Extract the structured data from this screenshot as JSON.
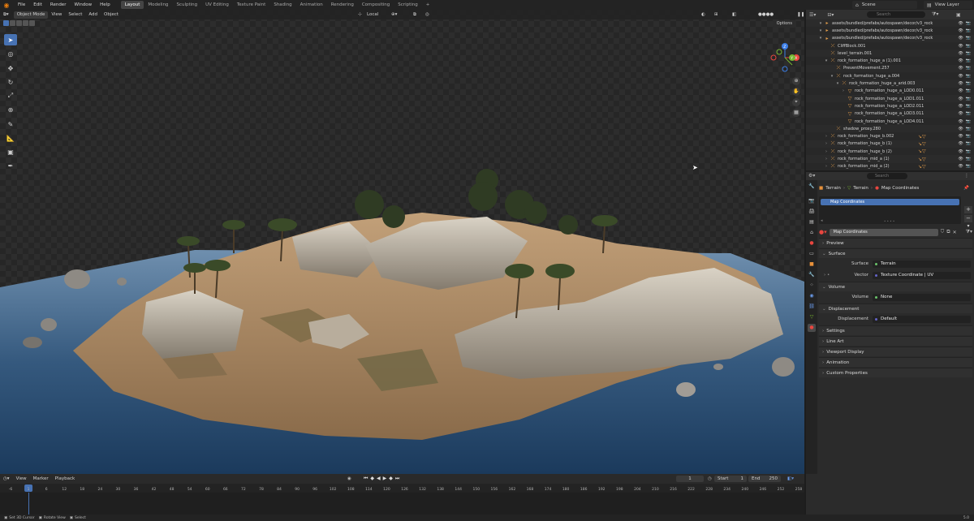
{
  "topbar": {
    "menus": [
      "File",
      "Edit",
      "Render",
      "Window",
      "Help"
    ],
    "workspaces": [
      "Layout",
      "Modeling",
      "Sculpting",
      "UV Editing",
      "Texture Paint",
      "Shading",
      "Animation",
      "Rendering",
      "Compositing",
      "Scripting"
    ],
    "active_workspace": "Layout",
    "add_tab": "+",
    "scene": "Scene",
    "view_layer": "View Layer"
  },
  "viewport": {
    "mode": "Object Mode",
    "menus": [
      "View",
      "Select",
      "Add",
      "Object"
    ],
    "transform_orientation": "Local",
    "options": "Options",
    "gizmo": {
      "x": "X",
      "y": "Y",
      "z": "Z"
    }
  },
  "outliner": {
    "search_placeholder": "Search",
    "rows": [
      {
        "indent": 2,
        "arrow": "▾",
        "icon": "folder",
        "name": "assets/bundled/prefabs/autospawn/decor/v3_rock"
      },
      {
        "indent": 2,
        "arrow": "▾",
        "icon": "folder",
        "name": "assets/bundled/prefabs/autospawn/decor/v3_rock"
      },
      {
        "indent": 2,
        "arrow": "▾",
        "icon": "folder",
        "name": "assets/bundled/prefabs/autospawn/decor/v3_rock"
      },
      {
        "indent": 3,
        "arrow": "",
        "icon": "empty",
        "name": "CliffBlock.001"
      },
      {
        "indent": 3,
        "arrow": "",
        "icon": "empty",
        "name": "level_terrain.001"
      },
      {
        "indent": 3,
        "arrow": "▾",
        "icon": "empty",
        "name": "rock_formation_huge_a (1).001"
      },
      {
        "indent": 4,
        "arrow": "",
        "icon": "empty",
        "name": "PreventMovement.257"
      },
      {
        "indent": 4,
        "arrow": "▾",
        "icon": "empty",
        "name": "rock_formation_huge_a.004"
      },
      {
        "indent": 5,
        "arrow": "▾",
        "icon": "empty",
        "name": "rock_formation_huge_a_arid.003"
      },
      {
        "indent": 6,
        "arrow": "›",
        "icon": "mesh",
        "name": "rock_formation_huge_a_LOD0.011"
      },
      {
        "indent": 6,
        "arrow": "",
        "icon": "mesh",
        "name": "rock_formation_huge_a_LOD1.011"
      },
      {
        "indent": 6,
        "arrow": "",
        "icon": "mesh",
        "name": "rock_formation_huge_a_LOD2.011"
      },
      {
        "indent": 6,
        "arrow": "",
        "icon": "mesh",
        "name": "rock_formation_huge_a_LOD3.011"
      },
      {
        "indent": 6,
        "arrow": "",
        "icon": "mesh",
        "name": "rock_formation_huge_a_LOD4.011"
      },
      {
        "indent": 4,
        "arrow": "",
        "icon": "empty",
        "name": "shadow_proxy.280"
      },
      {
        "indent": 3,
        "arrow": "›",
        "icon": "empty",
        "name": "rock_formation_huge_b.002",
        "mods": "↘▽"
      },
      {
        "indent": 3,
        "arrow": "›",
        "icon": "empty",
        "name": "rock_formation_huge_b (1)",
        "mods": "↘▽"
      },
      {
        "indent": 3,
        "arrow": "›",
        "icon": "empty",
        "name": "rock_formation_huge_b (2)",
        "mods": "↘▽"
      },
      {
        "indent": 3,
        "arrow": "›",
        "icon": "empty",
        "name": "rock_formation_mid_a (1)",
        "mods": "↘▽"
      },
      {
        "indent": 3,
        "arrow": "›",
        "icon": "empty",
        "name": "rock_formation_mid_a (2)",
        "mods": "↘▽"
      }
    ]
  },
  "properties": {
    "search_placeholder": "Search",
    "breadcrumb": [
      "Terrain",
      "Terrain",
      "Map Coordinates"
    ],
    "material_slot": "Map Coordinates",
    "material_name": "Map Coordinates",
    "list_dots": "• • • •",
    "panels": {
      "preview": "Preview",
      "surface": "Surface",
      "volume": "Volume",
      "displacement": "Displacement",
      "settings": "Settings",
      "line_art": "Line Art",
      "viewport_display": "Viewport Display",
      "animation": "Animation",
      "custom_properties": "Custom Properties"
    },
    "fields": {
      "surface_label": "Surface",
      "surface_value": "Terrain",
      "vector_label": "Vector",
      "vector_value": "Texture Coordinate | UV",
      "volume_label": "Volume",
      "volume_value": "None",
      "displacement_label": "Displacement",
      "displacement_value": "Default"
    }
  },
  "timeline": {
    "menus": [
      "View",
      "Marker",
      "Playback"
    ],
    "current_frame": "1",
    "start_label": "Start",
    "start_value": "1",
    "end_label": "End",
    "end_value": "250",
    "ticks": [
      "-6",
      "1",
      "6",
      "12",
      "18",
      "24",
      "30",
      "36",
      "42",
      "48",
      "54",
      "60",
      "66",
      "72",
      "78",
      "84",
      "90",
      "96",
      "102",
      "108",
      "114",
      "120",
      "126",
      "132",
      "138",
      "144",
      "150",
      "156",
      "162",
      "168",
      "174",
      "180",
      "186",
      "192",
      "198",
      "204",
      "210",
      "216",
      "222",
      "228",
      "234",
      "240",
      "246",
      "252",
      "258"
    ]
  },
  "statusbar": {
    "hints": [
      "Set 3D Cursor",
      "Rotate View",
      "Select"
    ],
    "version": "5.0"
  },
  "colors": {
    "accent": "#4772b3",
    "orange": "#e09b4a",
    "axis_x": "#e8463f",
    "axis_y": "#77b531",
    "axis_z": "#3c7ee6"
  }
}
